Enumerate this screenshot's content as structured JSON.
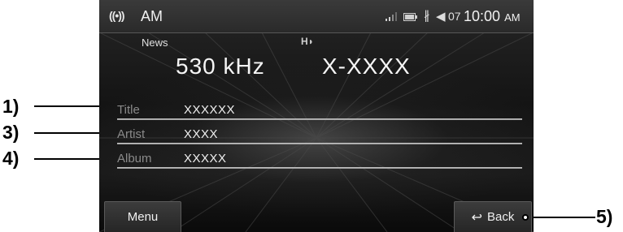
{
  "status_bar": {
    "band": "AM",
    "volume_level": "07",
    "clock_time": "10:00",
    "clock_ampm": "AM"
  },
  "station": {
    "genre": "News",
    "frequency": "530 kHz",
    "call_sign": "X-XXXX"
  },
  "info_rows": [
    {
      "label": "Title",
      "value": "XXXXXX"
    },
    {
      "label": "Artist",
      "value": "XXXX"
    },
    {
      "label": "Album",
      "value": "XXXXX"
    }
  ],
  "buttons": {
    "menu": "Menu",
    "back": "Back"
  },
  "callouts": [
    "1)",
    "3)",
    "4)",
    "5)"
  ],
  "icons": {
    "radio": "radio-waves-icon",
    "hd": "hd-radio-icon",
    "signal": "signal-strength-icon",
    "battery": "battery-icon",
    "bluetooth": "bluetooth-icon",
    "volume": "speaker-icon",
    "back": "back-arrow-icon"
  }
}
